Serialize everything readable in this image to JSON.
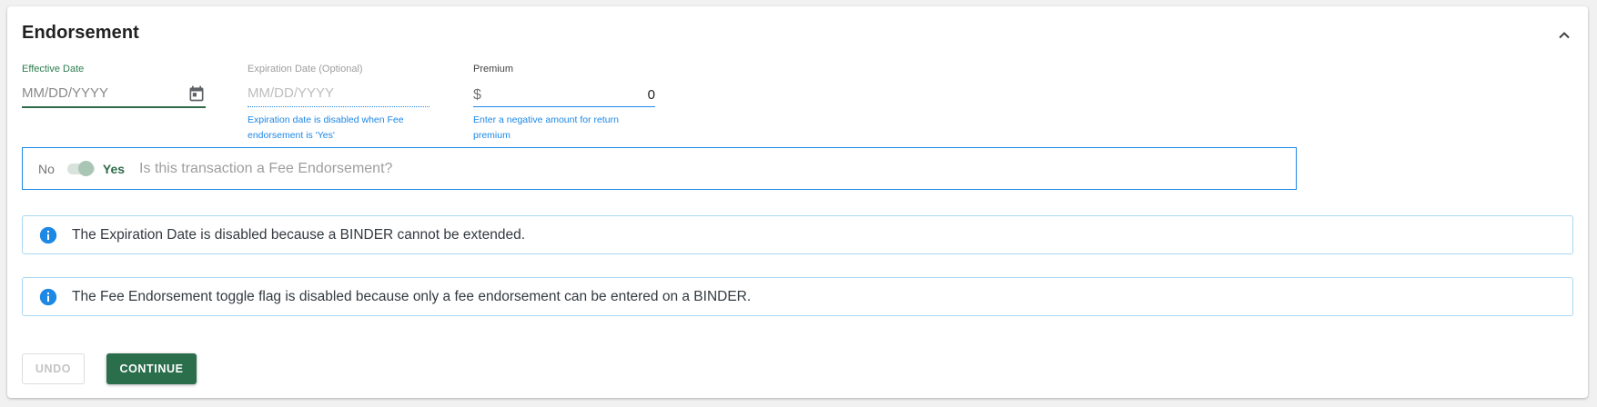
{
  "section": {
    "title": "Endorsement"
  },
  "effective_date": {
    "label": "Effective Date",
    "placeholder": "MM/DD/YYYY"
  },
  "expiration_date": {
    "label": "Expiration Date (Optional)",
    "placeholder": "MM/DD/YYYY",
    "hint": "Expiration date is disabled when Fee endorsement is 'Yes'"
  },
  "premium": {
    "label": "Premium",
    "currency_symbol": "$",
    "value": "0",
    "hint": "Enter a negative amount for return premium"
  },
  "fee_toggle": {
    "off_label": "No",
    "on_label": "Yes",
    "question": "Is this transaction a Fee Endorsement?",
    "state": "Yes"
  },
  "alerts": [
    {
      "icon": "info-icon",
      "message": "The Expiration Date is disabled because a BINDER cannot be extended."
    },
    {
      "icon": "info-icon",
      "message": "The Fee Endorsement toggle flag is disabled because only a fee endorsement can be entered on a BINDER."
    }
  ],
  "buttons": {
    "undo": "UNDO",
    "continue": "CONTINUE"
  },
  "colors": {
    "primary_green": "#2a6e4c",
    "info_blue": "#1e88e5",
    "alert_border": "#a9d8f2"
  }
}
